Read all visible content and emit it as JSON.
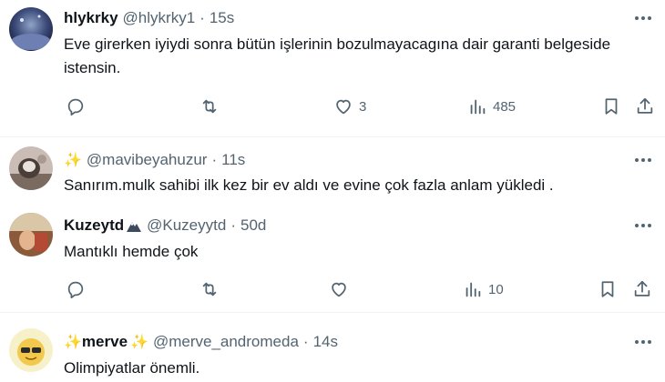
{
  "tweets": [
    {
      "name": "hlykrky",
      "handle": "@hlykrky1",
      "time": "15s",
      "text": "Eve girerken iyiydi sonra bütün işlerinin bozulmayacagına dair garanti belgeside istensin.",
      "replies": "",
      "retweets": "",
      "likes": "3",
      "views": "485"
    },
    {
      "name": "",
      "handle": "@mavibeyahuzur",
      "time": "11s",
      "text": "Sanırım.mulk sahibi ilk kez bir ev aldı ve evine çok fazla anlam yükledi ."
    },
    {
      "name": "Kuzeytd",
      "handle": "@Kuzeyytd",
      "time": "50d",
      "text": "Mantıklı hemde çok",
      "replies": "",
      "retweets": "",
      "likes": "",
      "views": "10"
    },
    {
      "name": "merve",
      "handle": "@merve_andromeda",
      "time": "14s",
      "text": "Olimpiyatlar önemli."
    }
  ],
  "separator": "·",
  "colors": {
    "text": "#0f1419",
    "secondary": "#536471",
    "sparkle": "#f5b800",
    "divider": "#eff3f4"
  },
  "icons": [
    "more-icon",
    "reply-icon",
    "retweet-icon",
    "like-icon",
    "views-icon",
    "bookmark-icon",
    "share-icon",
    "sparkle-icon",
    "mountain-emoji-icon"
  ]
}
